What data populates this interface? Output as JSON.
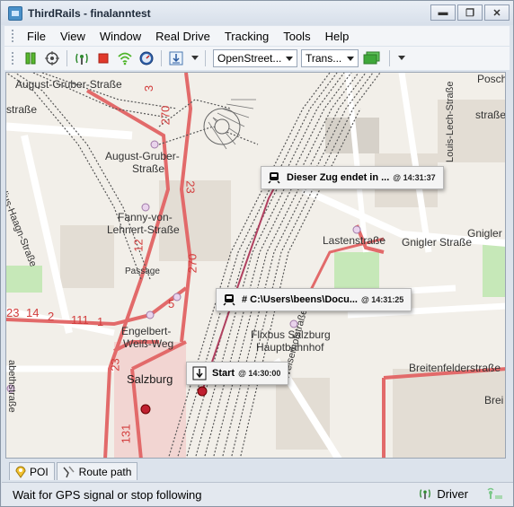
{
  "window": {
    "title": "ThirdRails - finalanntest"
  },
  "window_controls": {
    "minimize": "▬",
    "maximize": "❐",
    "close": "✕"
  },
  "menu": [
    "File",
    "View",
    "Window",
    "Real Drive",
    "Tracking",
    "Tools",
    "Help"
  ],
  "toolbar": {
    "map_source": "OpenStreet...",
    "overlay": "Trans...",
    "icons": [
      "pause-icon",
      "target-icon",
      "antenna-icon",
      "stop-icon",
      "wifi-icon",
      "gauge-icon",
      "download-icon",
      "map-layer-icon"
    ]
  },
  "map": {
    "callouts": [
      {
        "text": "Dieser Zug endet in ...",
        "time": "@ 14:31:37",
        "icon": "train-icon"
      },
      {
        "text": "# C:\\Users\\beens\\Docu...",
        "time": "@ 14:31:25",
        "icon": "train-icon"
      },
      {
        "text": "Start",
        "time": "@ 14:30:00",
        "icon": "start-icon"
      }
    ],
    "labels": {
      "gruber": "August-Gruber-Straße",
      "august_gruber_1": "August-Gruber-",
      "august_gruber_2": "Straße",
      "fanny_1": "Fanny-von-",
      "fanny_2": "Lehnert-Straße",
      "engelbert_1": "Engelbert-",
      "engelbert_2": "Weiß-Weg",
      "flixbus_1": "Flixbus Salzburg",
      "flixbus_2": "Hauptbahnhof",
      "salzburg": "Salzburg",
      "lastenstrasse": "Lastenstraße",
      "gnigler_strasse": "Gnigler Straße",
      "gnigler": "Gnigler",
      "breitenfelder": "Breitenfelderstraße",
      "passage": "Passage",
      "poschi": "Poschin",
      "strasse_left": "straße",
      "haagn": "Julius-Haagn-Straße",
      "abeth": "abethstraße",
      "weiser": "Weiserhofstraße",
      "louis": "Louis-Lech-Straße",
      "strasse_right": "straße",
      "brei": "Brei"
    },
    "road_numbers": [
      "270",
      "3",
      "23",
      "12",
      "270",
      "5",
      "23",
      "14",
      "2",
      "111",
      "1",
      "23",
      "131"
    ]
  },
  "tabs": [
    {
      "label": "POI",
      "icon": "poi-icon"
    },
    {
      "label": "Route path",
      "icon": "route-icon"
    }
  ],
  "status": {
    "message": "Wait for GPS signal or stop following",
    "mode": "Driver"
  }
}
